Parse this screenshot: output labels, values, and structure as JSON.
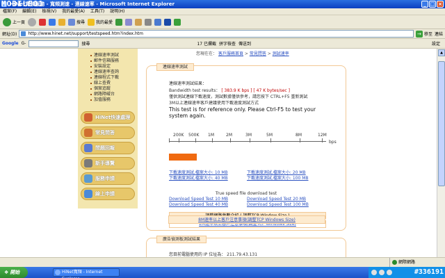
{
  "window": {
    "title": "HiNet寬頻服務 - 寬頻測速 - 連線速率 - Microsoft Internet Explorer",
    "watermark": "MOBILE01",
    "minimize": "_",
    "maximize": "□",
    "close": "×"
  },
  "menu": [
    "檔案(F)",
    "編輯(E)",
    "檢視(V)",
    "我的最愛(A)",
    "工具(T)",
    "說明(H)"
  ],
  "toolbar": {
    "back": "上一頁",
    "search": "搜尋",
    "favorites": "我的最愛"
  },
  "address": {
    "label": "網址(D)",
    "url": "http://www.hinet.net/support/testspeed.htm?index.htm",
    "go": "移至",
    "links": "連結"
  },
  "googlebar": {
    "label": "Google",
    "go": "G-",
    "items": [
      "搜尋",
      "17 已攔截",
      "拼字檢查",
      "傳送到",
      "設定"
    ]
  },
  "sidebar": {
    "links": [
      "連線速率測試",
      "郵件信箱服務",
      "安裝設定",
      "連線速率查詢",
      "連線程式下載",
      "線上查費",
      "個案追蹤",
      "網路障礙台",
      "加值服務"
    ],
    "buttons": [
      "HiNet快速處理",
      "常見問答",
      "問題回報",
      "新手導覽",
      "服務申請",
      "線上申請"
    ]
  },
  "breadcrumb": {
    "prefix": "您現在在：",
    "crumb1": "客戶服務首頁",
    "sep": " > ",
    "crumb2": "常見問答",
    "crumb3": "測試速率"
  },
  "speedtest": {
    "title": "連線速率測試",
    "result_label": "連線速率測試結果：",
    "bandwidth_label": "Bandwidth test results：",
    "result_kbps": "[ 383.9 K bps ]",
    "result_kbytes": "[ 47 K bytes/sec ]",
    "note_zh": "僅供測試連線下載速度，測試數據僅供參考，請您按下 CTRL+F5 重新測試",
    "note_zh2": "3M以上連線速率客戶建議使用下載速度測試方式",
    "note_en": "This test is for reference only. Please Ctrl-F5 to test your system again.",
    "scale_labels": [
      "200K",
      "500K",
      "1M",
      "2M",
      "3M",
      "5M",
      "8M",
      "12M"
    ],
    "unit": "bps",
    "measured_kbps": 383.9,
    "max_kbps": 12000,
    "dl_links_zh": [
      "下載速度測試,檔案大小: 10 MB",
      "下載速度測試,檔案大小: 20 MB",
      "下載速度測試,檔案大小: 40 MB",
      "下載速度測試,檔案大小: 100 MB"
    ],
    "true_speed_title": "True speed file download test",
    "dl_links_en": [
      "Download Speed Test 10 MB",
      "Download Speed Test 20 MB",
      "Download Speed Test 40 MB",
      "Download Speed Test 100 MB"
    ],
    "box_title": "調整網路參數介紹 ( 調整TCP Window Size )",
    "box_link1": "2M速率以上客戶注意事項(調整TCP Windows Size)",
    "box_link2": "8M速率以上客戶注意事項(調整TCP Windows Size)"
  },
  "panel2": {
    "title": "廣告偵測板測試結果",
    "ip_label": "您目前電腦使用的 IP 位址為：",
    "ip": "211.79.43.131"
  },
  "statusbar": {
    "zone": "網際網路"
  },
  "taskbar": {
    "start": "開始",
    "task": "HiNet寬頻 - Internet Explorer",
    "watermark": "#336191"
  }
}
